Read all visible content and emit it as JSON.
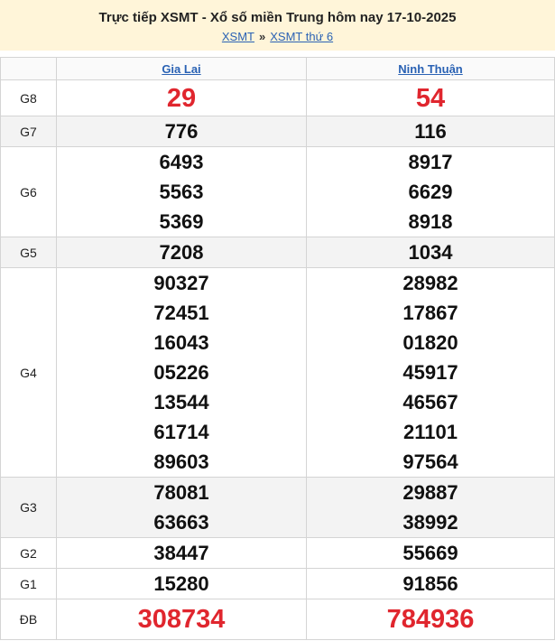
{
  "header": {
    "title": "Trực tiếp XSMT - Xổ số miền Trung hôm nay 17-10-2025",
    "breadcrumb": [
      "XSMT",
      "XSMT thứ 6"
    ],
    "separator": "»"
  },
  "provinces": [
    "Gia Lai",
    "Ninh Thuận"
  ],
  "prizes": [
    {
      "label": "G8",
      "values": [
        [
          "29"
        ],
        [
          "54"
        ]
      ]
    },
    {
      "label": "G7",
      "values": [
        [
          "776"
        ],
        [
          "116"
        ]
      ]
    },
    {
      "label": "G6",
      "values": [
        [
          "6493",
          "5563",
          "5369"
        ],
        [
          "8917",
          "6629",
          "8918"
        ]
      ]
    },
    {
      "label": "G5",
      "values": [
        [
          "7208"
        ],
        [
          "1034"
        ]
      ]
    },
    {
      "label": "G4",
      "values": [
        [
          "90327",
          "72451",
          "16043",
          "05226",
          "13544",
          "61714",
          "89603"
        ],
        [
          "28982",
          "17867",
          "01820",
          "45917",
          "46567",
          "21101",
          "97564"
        ]
      ]
    },
    {
      "label": "G3",
      "values": [
        [
          "78081",
          "63663"
        ],
        [
          "29887",
          "38992"
        ]
      ]
    },
    {
      "label": "G2",
      "values": [
        [
          "38447"
        ],
        [
          "55669"
        ]
      ]
    },
    {
      "label": "G1",
      "values": [
        [
          "15280"
        ],
        [
          "91856"
        ]
      ]
    },
    {
      "label": "ĐB",
      "values": [
        [
          "308734"
        ],
        [
          "784936"
        ]
      ]
    }
  ],
  "colors": {
    "highlight": "#e0262e",
    "link": "#2a62b4",
    "header_bg": "#fff5d9",
    "alt_row": "#f3f3f3"
  }
}
